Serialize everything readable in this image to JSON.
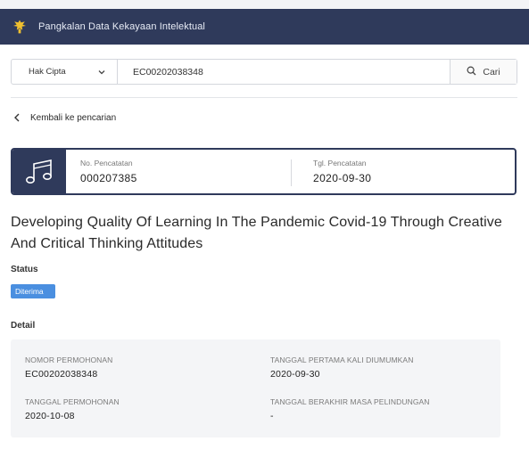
{
  "app": {
    "title": "Pangkalan Data Kekayaan Intelektual",
    "logo_icon": "garuda-emblem-icon"
  },
  "search": {
    "type_selected": "Hak Cipta",
    "query_value": "EC00202038348",
    "button_label": "Cari"
  },
  "back_link": {
    "label": "Kembali ke pencarian"
  },
  "record_card": {
    "icon": "music-note-icon",
    "reg_number_label": "No. Pencatatan",
    "reg_number_value": "000207385",
    "reg_date_label": "Tgl. Pencatatan",
    "reg_date_value": "2020-09-30"
  },
  "work": {
    "title": "Developing Quality Of Learning In The Pandemic Covid-19 Through Creative And Critical Thinking Attitudes"
  },
  "status": {
    "label": "Status",
    "badge": "Diterima",
    "badge_color": "#4a8fe0"
  },
  "detail": {
    "label": "Detail",
    "fields": [
      {
        "label": "NOMOR PERMOHONAN",
        "value": "EC00202038348"
      },
      {
        "label": "TANGGAL PERTAMA KALI DIUMUMKAN",
        "value": "2020-09-30"
      },
      {
        "label": "TANGGAL PERMOHONAN",
        "value": "2020-10-08"
      },
      {
        "label": "TANGGAL BERAKHIR MASA PELINDUNGAN",
        "value": "-"
      }
    ]
  },
  "colors": {
    "navbar": "#2f3a5b",
    "accent": "#4a8fe0"
  }
}
